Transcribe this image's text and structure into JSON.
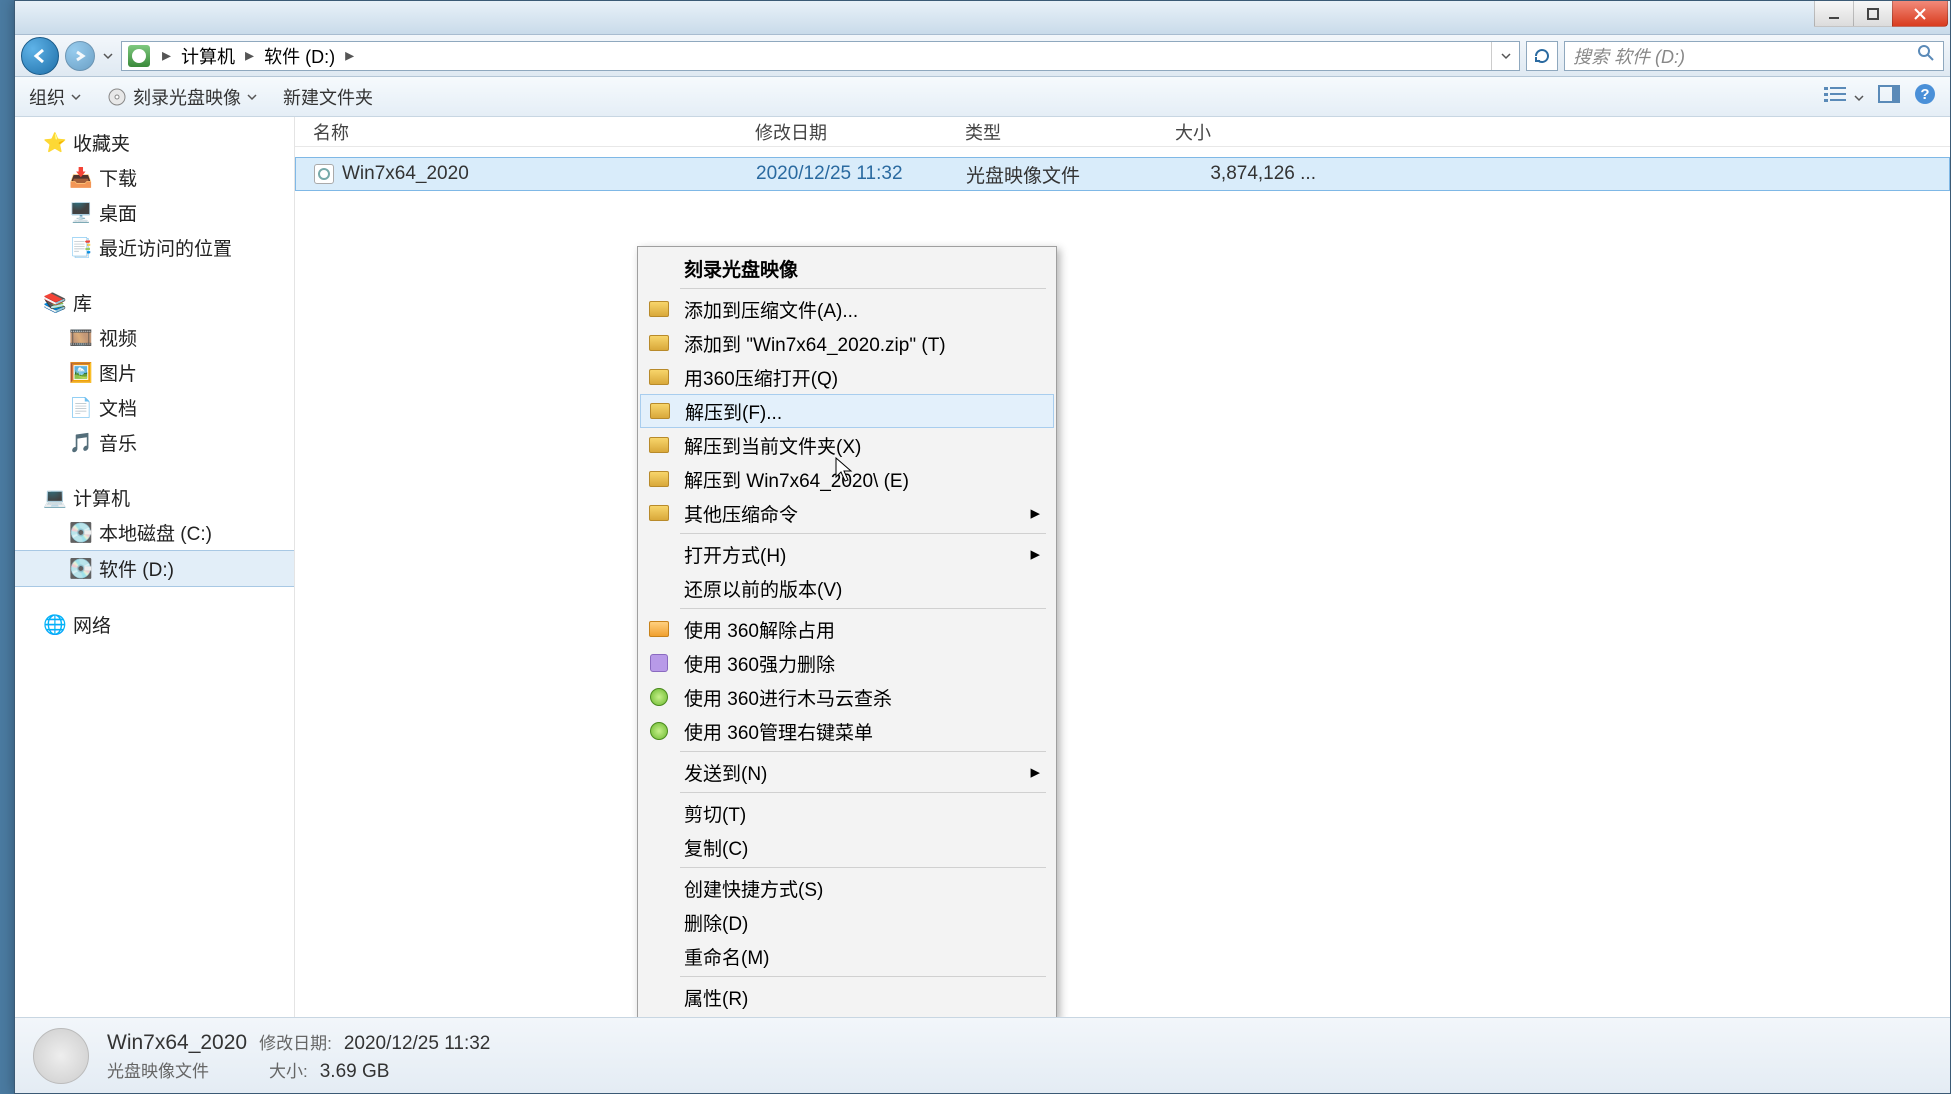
{
  "breadcrumb": {
    "root": "计算机",
    "current": "软件 (D:)"
  },
  "search": {
    "placeholder": "搜索 软件 (D:)"
  },
  "toolbar": {
    "organize": "组织",
    "burn": "刻录光盘映像",
    "newfolder": "新建文件夹"
  },
  "sidebar": {
    "favorites": {
      "head": "收藏夹",
      "items": [
        "下载",
        "桌面",
        "最近访问的位置"
      ]
    },
    "libraries": {
      "head": "库",
      "items": [
        "视频",
        "图片",
        "文档",
        "音乐"
      ]
    },
    "computer": {
      "head": "计算机",
      "items": [
        "本地磁盘 (C:)",
        "软件 (D:)"
      ]
    },
    "network": {
      "head": "网络"
    }
  },
  "columns": {
    "name": "名称",
    "date": "修改日期",
    "type": "类型",
    "size": "大小"
  },
  "files": [
    {
      "name": "Win7x64_2020",
      "date": "2020/12/25 11:32",
      "type": "光盘映像文件",
      "size": "3,874,126 ..."
    }
  ],
  "context": {
    "burn": "刻录光盘映像",
    "addto": "添加到压缩文件(A)...",
    "addtozip": "添加到 \"Win7x64_2020.zip\" (T)",
    "open360": "用360压缩打开(Q)",
    "extractto": "解压到(F)...",
    "extracthere": "解压到当前文件夹(X)",
    "extractfolder": "解压到 Win7x64_2020\\ (E)",
    "othercompress": "其他压缩命令",
    "openwith": "打开方式(H)",
    "restore": "还原以前的版本(V)",
    "unlock360": "使用 360解除占用",
    "forcedel360": "使用 360强力删除",
    "trojan360": "使用 360进行木马云查杀",
    "manage360": "使用 360管理右键菜单",
    "sendto": "发送到(N)",
    "cut": "剪切(T)",
    "copy": "复制(C)",
    "shortcut": "创建快捷方式(S)",
    "delete": "删除(D)",
    "rename": "重命名(M)",
    "properties": "属性(R)"
  },
  "status": {
    "name": "Win7x64_2020",
    "type": "光盘映像文件",
    "date_label": "修改日期:",
    "date": "2020/12/25 11:32",
    "size_label": "大小:",
    "size": "3.69 GB"
  }
}
